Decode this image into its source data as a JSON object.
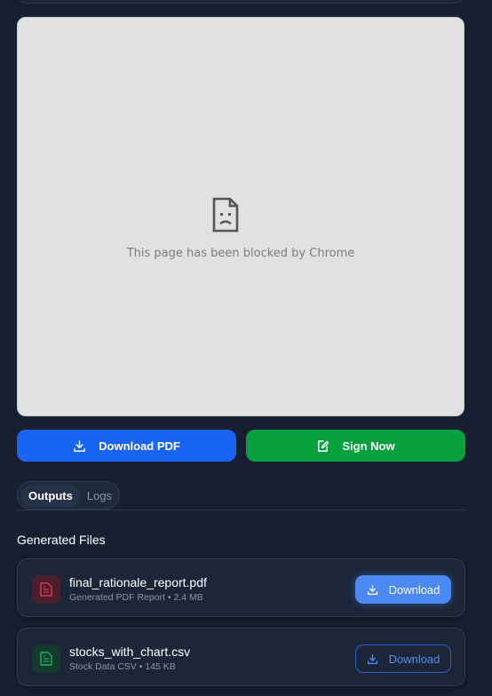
{
  "preview": {
    "blocked_message": "This page has been blocked by Chrome"
  },
  "actions": {
    "download_pdf_label": "Download PDF",
    "sign_now_label": "Sign Now"
  },
  "tabs": {
    "outputs_label": "Outputs",
    "logs_label": "Logs",
    "active": "Outputs"
  },
  "files_section": {
    "title": "Generated Files",
    "files": [
      {
        "name": "final_rationale_report.pdf",
        "meta": "Generated PDF Report • 2.4 MB",
        "icon": "file-text-icon",
        "download_label": "Download"
      },
      {
        "name": "stocks_with_chart.csv",
        "meta": "Stock Data CSV • 145 KB",
        "icon": "file-text-icon",
        "download_label": "Download"
      }
    ]
  },
  "colors": {
    "background": "#172031",
    "primary_blue": "#1a64f4",
    "success_green": "#06a03e",
    "pdf_icon_red": "#e0344f",
    "csv_icon_green": "#19b35a",
    "download_blue": "#4a8af2"
  }
}
